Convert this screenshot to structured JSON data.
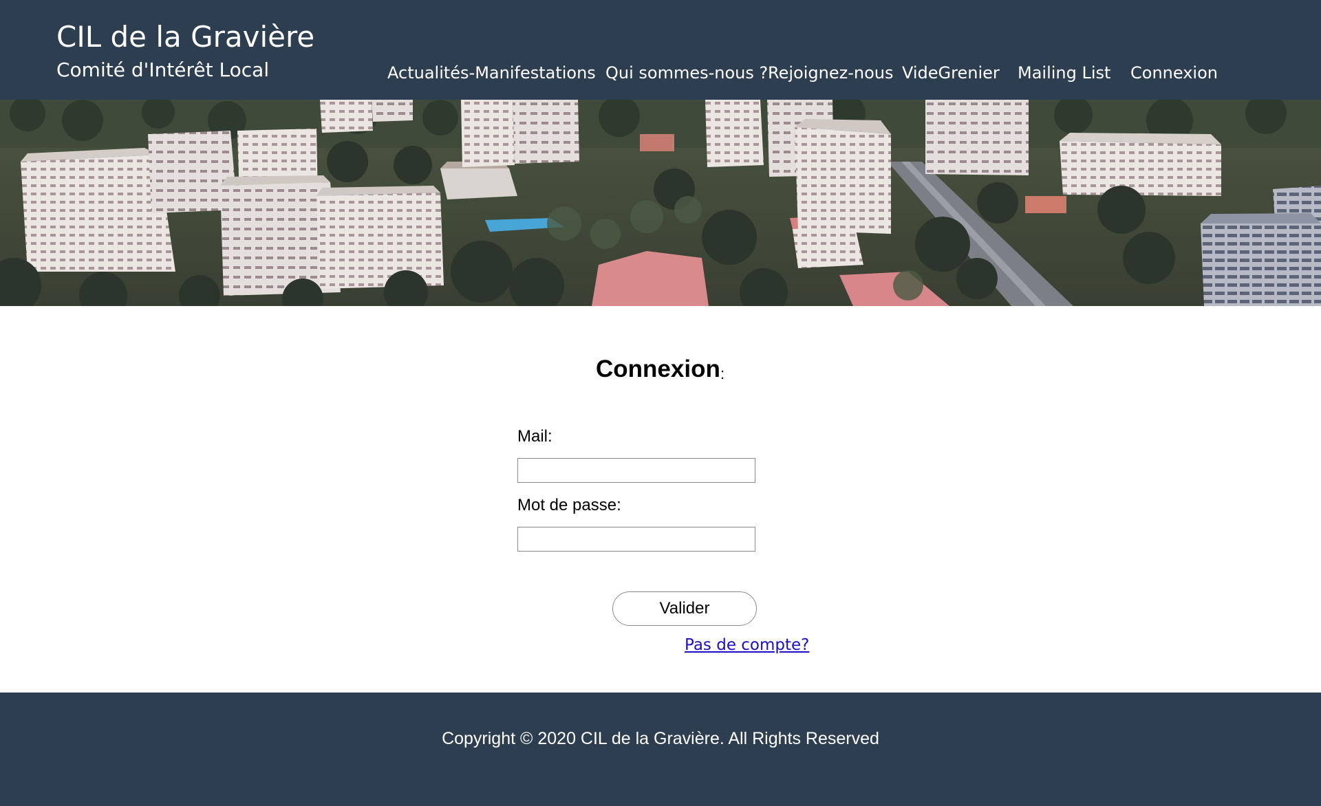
{
  "header": {
    "title": "CIL de la Gravière",
    "subtitle": "Comité d'Intérêt Local",
    "background_color": "#2e3e51"
  },
  "nav": {
    "items": [
      {
        "label": "Actualités-Manifestations"
      },
      {
        "label": "Qui sommes-nous ?"
      },
      {
        "label": "Rejoignez-nous"
      },
      {
        "label": "VideGrenier"
      },
      {
        "label": "Mailing List"
      },
      {
        "label": "Connexion"
      }
    ]
  },
  "login": {
    "title": "Connexion",
    "title_suffix": ":",
    "mail_label": "Mail:",
    "mail_value": "",
    "password_label": "Mot de passe:",
    "password_value": "",
    "submit_label": "Valider",
    "register_link": "Pas de compte?"
  },
  "footer": {
    "copyright": "Copyright © 2020 CIL de la Gravière. All Rights Reserved"
  },
  "colors": {
    "brand_dark": "#2e3e51",
    "link": "#1a0dcc"
  }
}
